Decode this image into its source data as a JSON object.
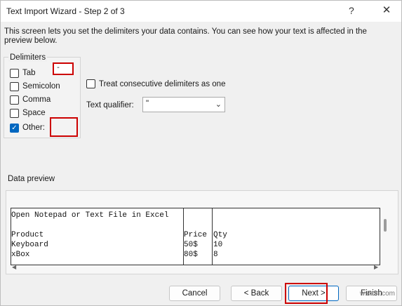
{
  "window": {
    "title": "Text Import Wizard - Step 2 of 3",
    "help_glyph": "?",
    "close_glyph": "✕"
  },
  "description": "This screen lets you set the delimiters your data contains.  You can see how your text is affected in the preview below.",
  "delimiters": {
    "group_label": "Delimiters",
    "items": [
      {
        "label": "Tab",
        "checked": false
      },
      {
        "label": "Semicolon",
        "checked": false
      },
      {
        "label": "Comma",
        "checked": false
      },
      {
        "label": "Space",
        "checked": false
      },
      {
        "label": "Other:",
        "checked": true
      }
    ],
    "other_value": "-"
  },
  "options": {
    "consecutive_label": "Treat consecutive delimiters as one",
    "consecutive_checked": false,
    "qualifier_label": "Text qualifier:",
    "qualifier_value": "\"",
    "qualifier_arrow": "⌄"
  },
  "preview": {
    "label": "Data preview",
    "rows": [
      [
        "Open Notepad or Text File in Excel",
        "",
        ""
      ],
      [
        "",
        "",
        ""
      ],
      [
        "Product",
        "Price",
        "Qty"
      ],
      [
        "Keyboard",
        "50$",
        "10"
      ],
      [
        "xBox",
        "80$",
        "8"
      ]
    ]
  },
  "buttons": {
    "cancel": "Cancel",
    "back": "< Back",
    "next": "Next >",
    "finish": "Finish"
  },
  "watermark": "wsxdn.com",
  "colors": {
    "accent": "#0067c0",
    "highlight": "#cc0000"
  }
}
